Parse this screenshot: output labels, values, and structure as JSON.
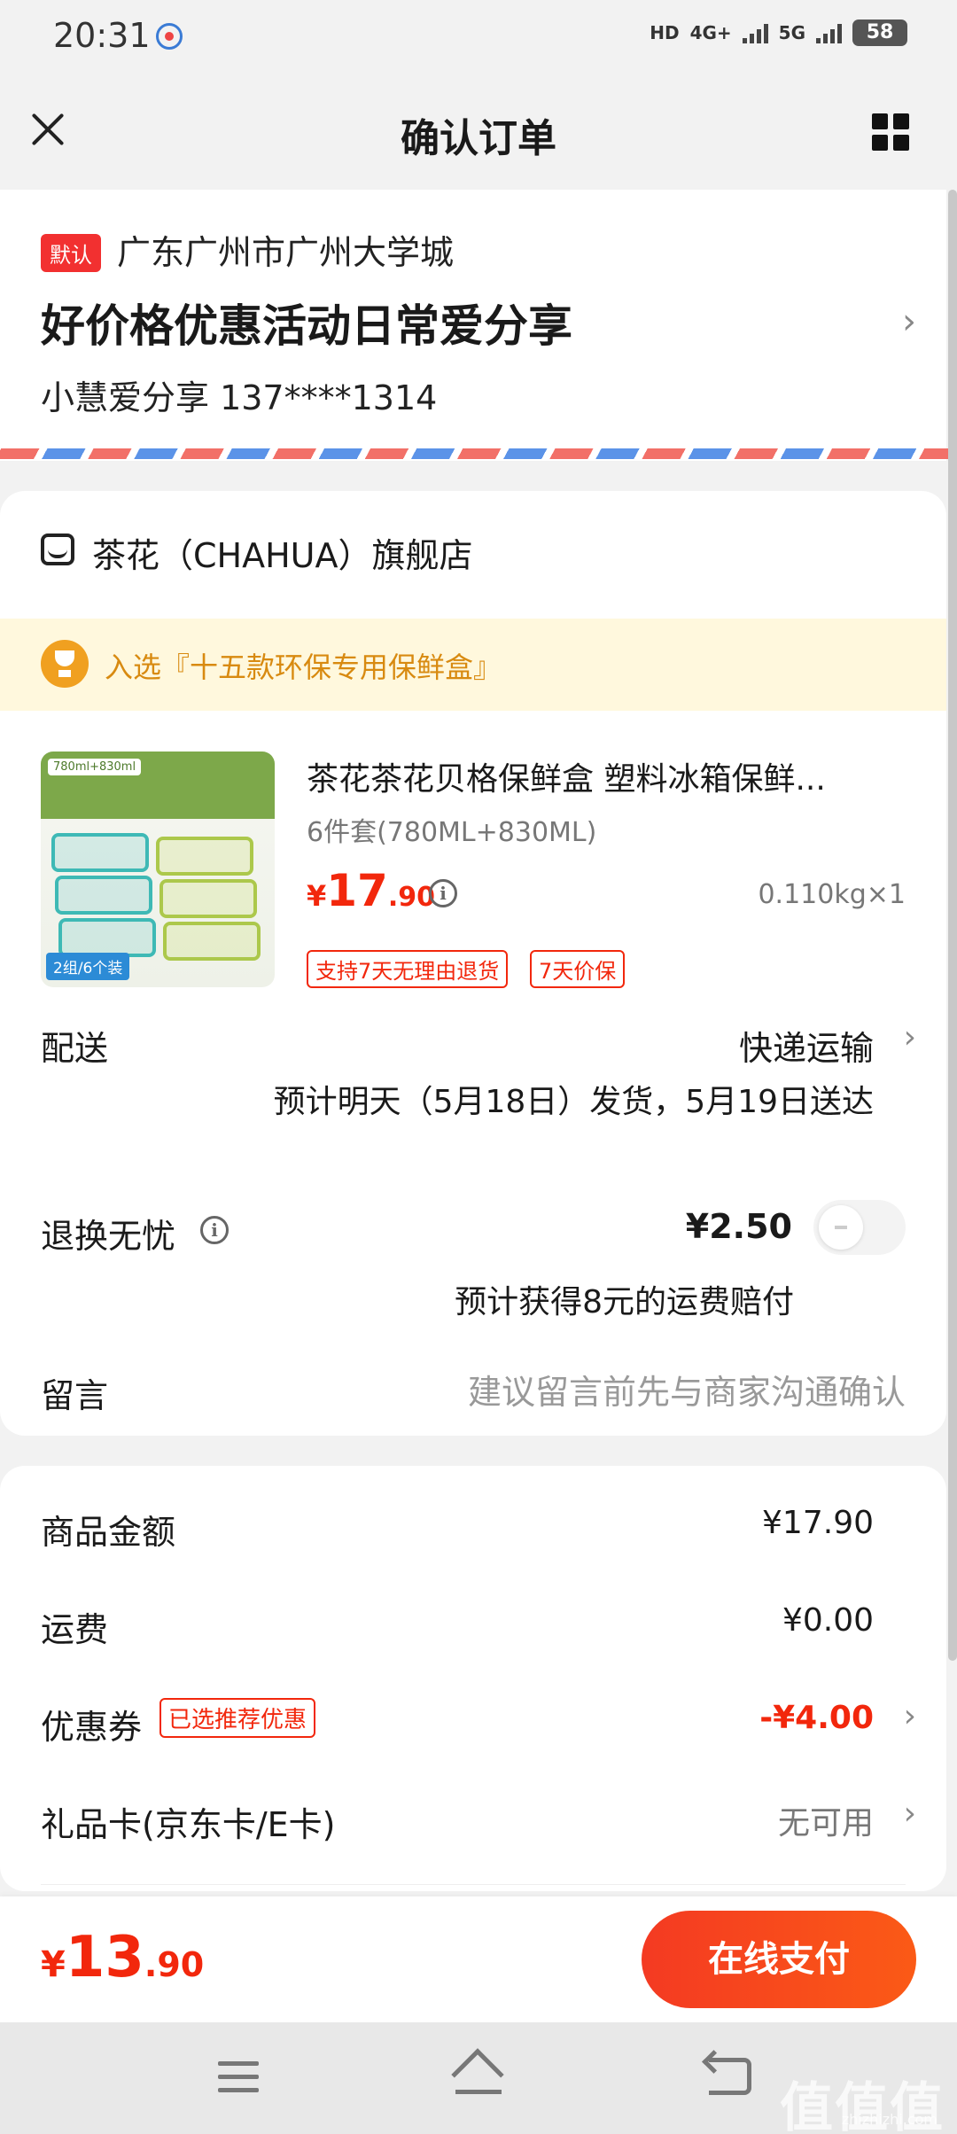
{
  "status_bar": {
    "time": "20:31",
    "network_1": "HD",
    "network_2": "4G+",
    "network_3": "5G",
    "battery": "58"
  },
  "header": {
    "title": "确认订单",
    "close_icon": "close-icon",
    "menu_icon": "grid-icon"
  },
  "address": {
    "default_badge": "默认",
    "region": "广东广州市广州大学城",
    "detail": "好价格优惠活动日常爱分享",
    "contact": "小慧爱分享 137****1314"
  },
  "shop": {
    "store_name": "茶花（CHAHUA）旗舰店",
    "promo": "入选『十五款环保专用保鲜盒』",
    "product": {
      "title": "茶花茶花贝格保鲜盒 塑料冰箱保鲜...",
      "spec": "6件套(780ML+830ML)",
      "price_currency": "¥",
      "price_int": "17",
      "price_dec": ".90",
      "weight_qty": "0.110kg×1",
      "tag_return": "支持7天无理由退货",
      "tag_price": "7天价保",
      "image": {
        "label": "780ml+830ml",
        "corner_tag": "2组/6个装"
      }
    },
    "delivery": {
      "label": "配送",
      "method": "快递运输",
      "estimate": "预计明天（5月18日）发货，5月19日送达"
    },
    "return_service": {
      "label": "退换无忧",
      "price": "¥2.50",
      "compensation": "预计获得8元的运费赔付",
      "enabled": false
    },
    "message": {
      "label": "留言",
      "placeholder": "建议留言前先与商家沟通确认"
    }
  },
  "summary": {
    "goods_label": "商品金额",
    "goods_value": "¥17.90",
    "shipping_label": "运费",
    "shipping_value": "¥0.00",
    "coupon_label": "优惠券",
    "coupon_tag": "已选推荐优惠",
    "coupon_value": "-¥4.00",
    "giftcard_label": "礼品卡(京东卡/E卡)",
    "giftcard_value": "无可用"
  },
  "footer": {
    "total_currency": "¥",
    "total_int": "13",
    "total_dec": ".90",
    "pay_button": "在线支付"
  },
  "watermark": {
    "text": "值值值",
    "sub": "zhizhizhi.com"
  },
  "colors": {
    "accent_red": "#f2270c",
    "promo_orange": "#d88a10",
    "pay_gradient_start": "#f43a22",
    "pay_gradient_end": "#fb5a16"
  }
}
